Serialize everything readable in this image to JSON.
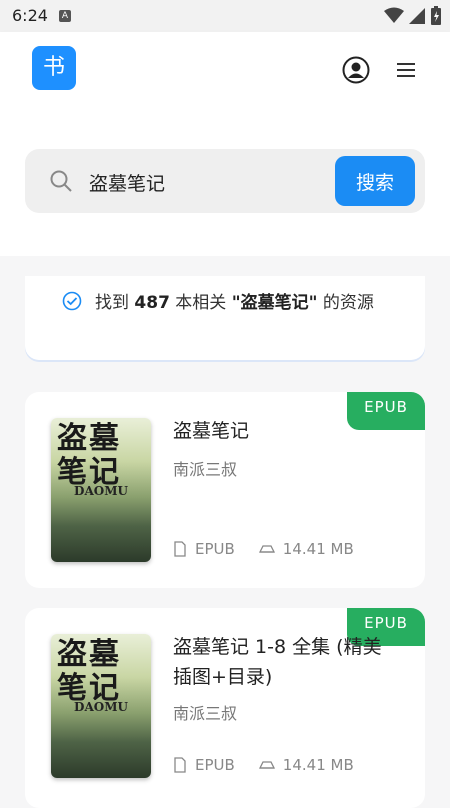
{
  "status": {
    "time": "6:24",
    "a_icon_label": "A"
  },
  "header": {
    "logo_text": "书"
  },
  "search": {
    "value": "盗墓笔记",
    "placeholder": "",
    "button_label": "搜索"
  },
  "result": {
    "prefix": "找到 ",
    "count": "487",
    "middle": " 本相关 ",
    "query": "\"盗墓笔记\"",
    "suffix": " 的资源"
  },
  "books": [
    {
      "title": "盗墓笔记",
      "author": "南派三叔",
      "badge": "EPUB",
      "format": "EPUB",
      "size": "14.41 MB",
      "cover_title": "盗墓笔记",
      "cover_brand": "DAOMU"
    },
    {
      "title": "盗墓笔记 1-8 全集 (精美插图+目录)",
      "author": "南派三叔",
      "badge": "EPUB",
      "format": "EPUB",
      "size": "14.41 MB",
      "cover_title": "盗墓笔记",
      "cover_brand": "DAOMU"
    }
  ],
  "colors": {
    "accent": "#1b8cf4",
    "badge": "#27ae60"
  }
}
